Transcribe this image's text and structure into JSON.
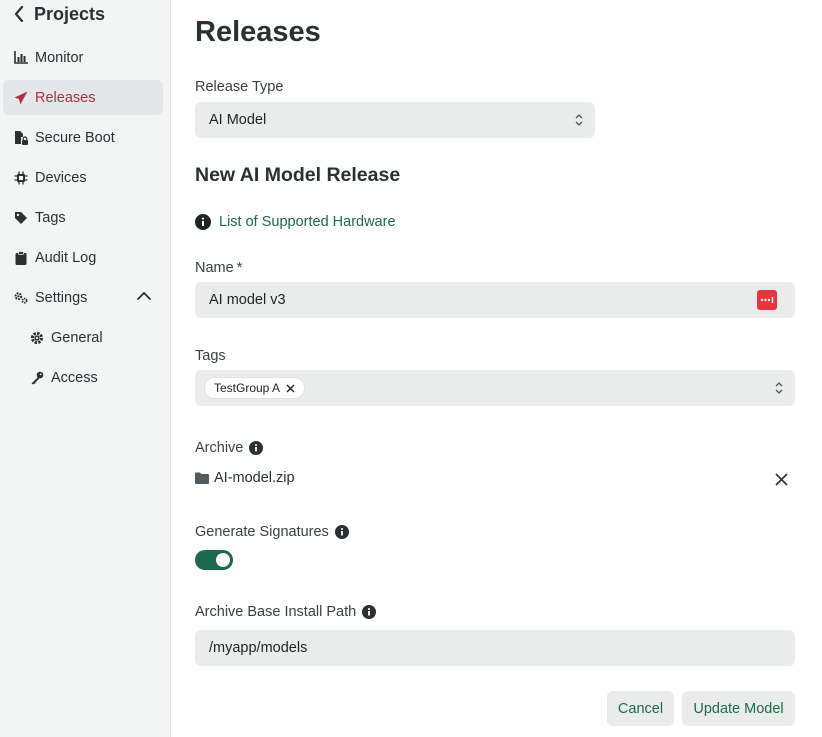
{
  "sidebar": {
    "back_label": "Projects",
    "items": [
      {
        "label": "Monitor",
        "icon": "bar-chart-icon"
      },
      {
        "label": "Releases",
        "icon": "paper-plane-icon",
        "active": true
      },
      {
        "label": "Secure Boot",
        "icon": "file-lock-icon"
      },
      {
        "label": "Devices",
        "icon": "chip-icon"
      },
      {
        "label": "Tags",
        "icon": "tag-icon"
      },
      {
        "label": "Audit Log",
        "icon": "clipboard-icon"
      },
      {
        "label": "Settings",
        "icon": "gears-icon",
        "expanded": true
      }
    ],
    "sub_items": [
      {
        "label": "General",
        "icon": "gear-icon"
      },
      {
        "label": "Access",
        "icon": "key-icon"
      }
    ]
  },
  "main": {
    "title": "Releases",
    "release_type": {
      "label": "Release Type",
      "value": "AI Model"
    },
    "section_title": "New AI Model Release",
    "hardware_link": "List of Supported Hardware",
    "name": {
      "label": "Name",
      "required_mark": "*",
      "value": "AI model v3"
    },
    "tags": {
      "label": "Tags",
      "chips": [
        "TestGroup A"
      ]
    },
    "archive": {
      "label": "Archive",
      "file_name": "AI-model.zip"
    },
    "signatures": {
      "label": "Generate Signatures",
      "enabled": true
    },
    "install_path": {
      "label": "Archive Base Install Path",
      "value": "/myapp/models"
    },
    "buttons": {
      "cancel": "Cancel",
      "submit": "Update Model"
    }
  },
  "colors": {
    "accent": "#1d6a4a",
    "active_nav": "#b32d43",
    "field_bg": "#e9eceb",
    "password_icon": "#e8343a"
  }
}
